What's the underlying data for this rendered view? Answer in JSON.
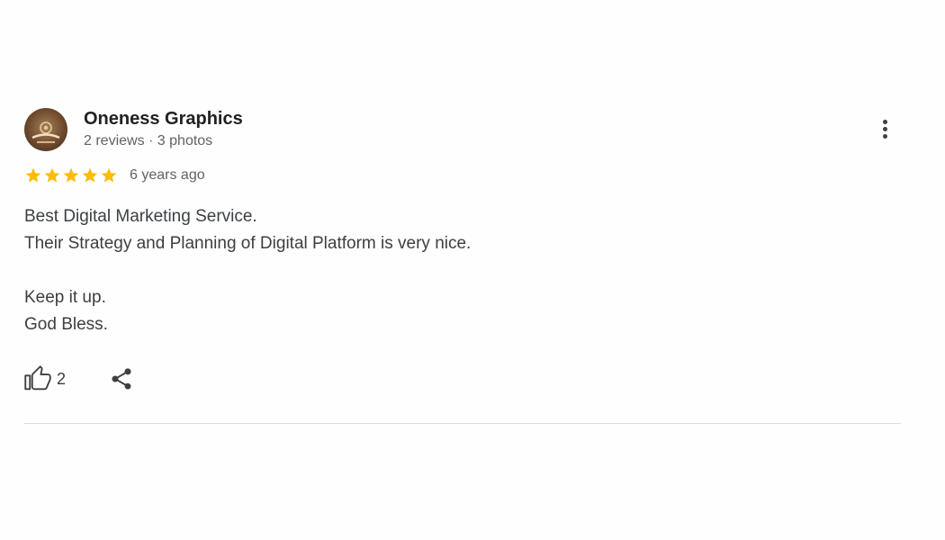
{
  "author": {
    "name": "Oneness Graphics",
    "meta": "2 reviews · 3 photos",
    "avatar_icon": "oneness-logo-avatar"
  },
  "rating": {
    "stars": 5,
    "max": 5,
    "star_color": "#fbbc04",
    "time_ago": "6 years ago"
  },
  "review": {
    "lines": [
      "Best Digital Marketing Service.",
      "Their Strategy and Planning of Digital Platform is very nice.",
      "",
      "Keep it up.",
      "God Bless."
    ]
  },
  "actions": {
    "like_icon": "thumbs-up-icon",
    "like_count": "2",
    "share_icon": "share-icon",
    "more_icon": "more-vert-icon"
  }
}
